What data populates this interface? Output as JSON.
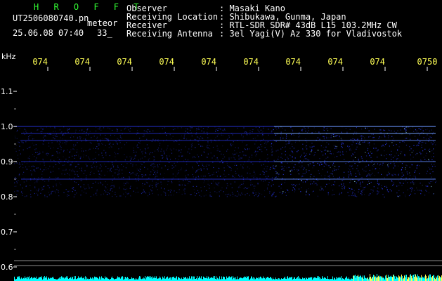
{
  "header": {
    "app_name": "H R O F F T",
    "file_name": "UT2506080740.pn",
    "mode": "meteor",
    "datetime": "25.06.08 07:40",
    "extra_value": "33_",
    "observer_label": "Observer",
    "observer_value": ": Masaki Kano",
    "location_label": "Receiving Location",
    "location_value": ": Shibukawa, Gunma, Japan",
    "receiver_label": "Receiver",
    "receiver_value": ": RTL-SDR SDR# 43dB L15 103.2MHz CW",
    "antenna_label": "Receiving Antenna",
    "antenna_value": ": 3el Yagi(V) Az 330 for Vladivostok"
  },
  "chart_data": {
    "type": "heatmap",
    "ylabel": "kHz",
    "y_ticks": [
      "1.1",
      "1.0",
      "0.9",
      "0.8",
      "0.7",
      "0.6"
    ],
    "x_ticks": [
      "074",
      "074",
      "074",
      "074",
      "074",
      "074",
      "074",
      "074",
      "074",
      "0750"
    ],
    "x_range": [
      "07:40",
      "07:50"
    ],
    "y_range_khz": [
      0.58,
      1.15
    ],
    "signal_bands_khz": [
      1.0,
      0.98,
      0.96,
      0.9,
      0.85
    ],
    "colors": {
      "background": "#000000",
      "signal": "#2c3cff",
      "signal_strong": "#9fe3ff",
      "noise_baseline": "#00ffff",
      "tick_text_time": "#ffff55",
      "tick_text_freq": "#ffffff",
      "header_title": "#33ff33"
    }
  }
}
